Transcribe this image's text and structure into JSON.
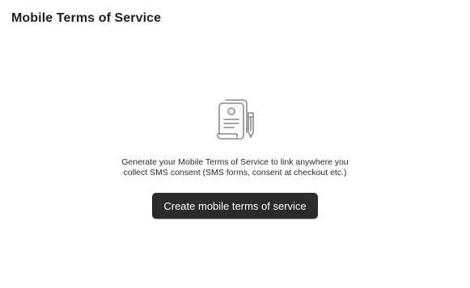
{
  "page": {
    "title": "Mobile Terms of Service"
  },
  "empty_state": {
    "icon": "document-with-pen-icon",
    "description": "Generate your Mobile Terms of Service to link anywhere you collect SMS consent (SMS forms, consent at checkout etc.)",
    "button_label": "Create mobile terms of service"
  },
  "colors": {
    "button_background": "#2b2b2b",
    "button_text": "#ffffff",
    "icon_stroke": "#8a8a8a"
  }
}
